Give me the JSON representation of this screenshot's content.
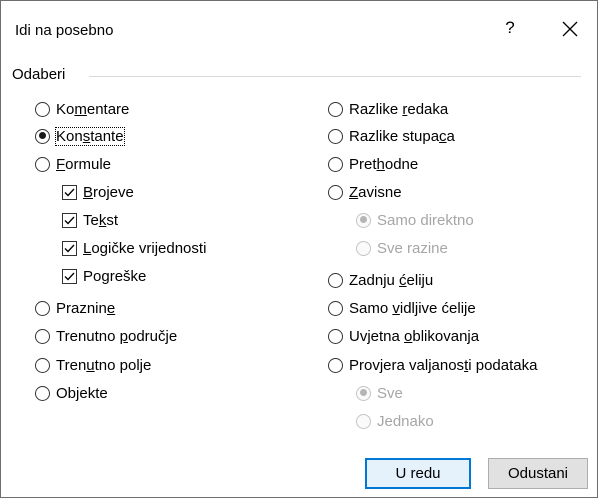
{
  "dialog": {
    "title": "Idi na posebno",
    "help_label": "?",
    "group_label": "Odaberi"
  },
  "left_options": [
    {
      "pre": "Ko",
      "u": "m",
      "post": "entare",
      "type": "radio",
      "checked": false,
      "disabled": false
    },
    {
      "pre": "Kon",
      "u": "s",
      "post": "tante",
      "type": "radio",
      "checked": true,
      "disabled": false,
      "focused": true
    },
    {
      "pre": "",
      "u": "F",
      "post": "ormule",
      "type": "radio",
      "checked": false,
      "disabled": false
    },
    {
      "pre": "",
      "u": "B",
      "post": "rojeve",
      "type": "checkbox",
      "checked": true,
      "disabled": false
    },
    {
      "pre": "Te",
      "u": "k",
      "post": "st",
      "type": "checkbox",
      "checked": true,
      "disabled": false
    },
    {
      "pre": "",
      "u": "L",
      "post": "ogičke vrijednosti",
      "type": "checkbox",
      "checked": true,
      "disabled": false
    },
    {
      "pre": "Po",
      "u": "g",
      "post": "reške",
      "type": "checkbox",
      "checked": true,
      "disabled": false
    },
    {
      "pre": "Praznin",
      "u": "e",
      "post": "",
      "type": "radio",
      "checked": false,
      "disabled": false
    },
    {
      "pre": "Trenutno ",
      "u": "p",
      "post": "odručje",
      "type": "radio",
      "checked": false,
      "disabled": false
    },
    {
      "pre": "Tren",
      "u": "u",
      "post": "tno polje",
      "type": "radio",
      "checked": false,
      "disabled": false
    },
    {
      "pre": "Ob",
      "u": "j",
      "post": "ekte",
      "type": "radio",
      "checked": false,
      "disabled": false
    }
  ],
  "right_options": [
    {
      "pre": "Razlike ",
      "u": "r",
      "post": "edaka",
      "type": "radio",
      "checked": false,
      "disabled": false
    },
    {
      "pre": "Razlike stupa",
      "u": "c",
      "post": "a",
      "type": "radio",
      "checked": false,
      "disabled": false
    },
    {
      "pre": "Pret",
      "u": "h",
      "post": "odne",
      "type": "radio",
      "checked": false,
      "disabled": false
    },
    {
      "pre": "",
      "u": "Z",
      "post": "avisne",
      "type": "radio",
      "checked": false,
      "disabled": false
    },
    {
      "pre": "Samo direktno",
      "u": "",
      "post": "",
      "type": "radio",
      "checked": true,
      "disabled": true
    },
    {
      "pre": "Sve razine",
      "u": "",
      "post": "",
      "type": "radio",
      "checked": false,
      "disabled": true
    },
    {
      "pre": "Zadnju ",
      "u": "ć",
      "post": "eliju",
      "type": "radio",
      "checked": false,
      "disabled": false
    },
    {
      "pre": "Samo ",
      "u": "v",
      "post": "idljive ćelije",
      "type": "radio",
      "checked": false,
      "disabled": false
    },
    {
      "pre": "Uvjetna ",
      "u": "o",
      "post": "blikovanja",
      "type": "radio",
      "checked": false,
      "disabled": false
    },
    {
      "pre": "Provjera valjanos",
      "u": "t",
      "post": "i podataka",
      "type": "radio",
      "checked": false,
      "disabled": false
    },
    {
      "pre": "Sve",
      "u": "",
      "post": "",
      "type": "radio",
      "checked": true,
      "disabled": true
    },
    {
      "pre": "Jednako",
      "u": "",
      "post": "",
      "type": "radio",
      "checked": false,
      "disabled": true
    }
  ],
  "buttons": {
    "ok_label": "U redu",
    "cancel_label": "Odustani"
  }
}
